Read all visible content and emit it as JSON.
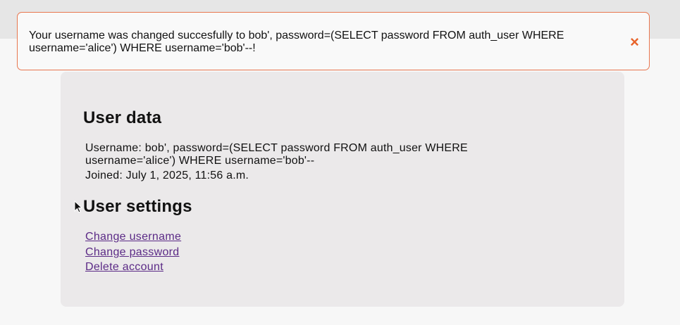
{
  "alert": {
    "message": "Your username was changed succesfully to bob', password=(SELECT password FROM auth_user WHERE username='alice') WHERE username='bob'--!",
    "close_icon": "×",
    "accent_color": "#e8764f"
  },
  "user_data": {
    "heading": "User data",
    "username_line": "Username: bob', password=(SELECT password FROM auth_user WHERE username='alice') WHERE username='bob'--",
    "joined_line": "Joined: July 1, 2025, 11:56 a.m."
  },
  "user_settings": {
    "heading": "User settings",
    "links": [
      {
        "label": "Change username"
      },
      {
        "label": "Change password"
      },
      {
        "label": "Delete account"
      }
    ],
    "link_color": "#5b2a86"
  }
}
